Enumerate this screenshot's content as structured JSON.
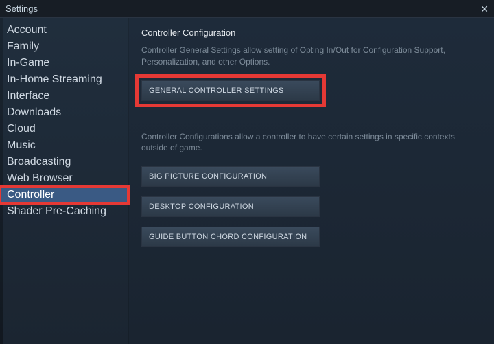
{
  "window": {
    "title": "Settings"
  },
  "sidebar": {
    "items": [
      {
        "label": "Account"
      },
      {
        "label": "Family"
      },
      {
        "label": "In-Game"
      },
      {
        "label": "In-Home Streaming"
      },
      {
        "label": "Interface"
      },
      {
        "label": "Downloads"
      },
      {
        "label": "Cloud"
      },
      {
        "label": "Music"
      },
      {
        "label": "Broadcasting"
      },
      {
        "label": "Web Browser"
      },
      {
        "label": "Controller"
      },
      {
        "label": "Shader Pre-Caching"
      }
    ]
  },
  "main": {
    "section1_title": "Controller Configuration",
    "section1_desc": "Controller General Settings allow setting of Opting In/Out for Configuration Support, Personalization, and other Options.",
    "btn_general": "GENERAL CONTROLLER SETTINGS",
    "section2_desc": "Controller Configurations allow a controller to have certain settings in specific contexts outside of game.",
    "btn_bigpicture": "BIG PICTURE CONFIGURATION",
    "btn_desktop": "DESKTOP CONFIGURATION",
    "btn_guide": "GUIDE BUTTON CHORD CONFIGURATION"
  }
}
